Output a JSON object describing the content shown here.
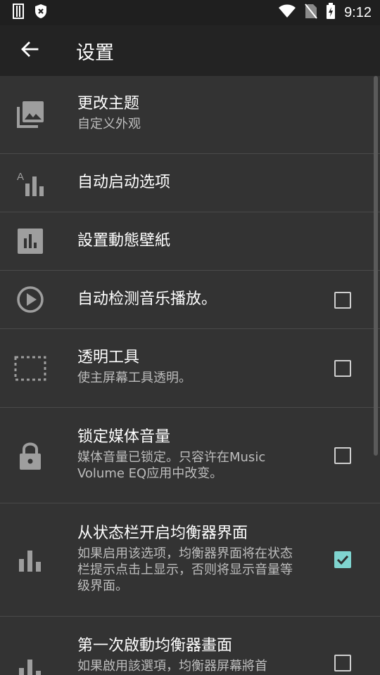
{
  "status_bar": {
    "time": "9:12",
    "icons": [
      "sim-icon",
      "shield-icon",
      "wifi-icon",
      "no-sim-icon",
      "battery-charging-icon"
    ]
  },
  "app_bar": {
    "title": "设置",
    "back_icon": "arrow-back-icon"
  },
  "colors": {
    "background": "#2e2e2e",
    "app_bar": "#232323",
    "accent_checkbox": "#7fd4cf",
    "subtitle_text": "#bdbdbd"
  },
  "settings": [
    {
      "title": "更改主题",
      "subtitle": "自定义外观",
      "icon": "photo-library-icon",
      "checkbox": null
    },
    {
      "title": "自动启动选项",
      "subtitle": "",
      "icon": "auto-equalizer-icon",
      "checkbox": null
    },
    {
      "title": "設置動態壁紙",
      "subtitle": "",
      "icon": "bar-chart-icon",
      "checkbox": null
    },
    {
      "title": "自动检测音乐播放。",
      "subtitle": "",
      "icon": "play-circle-icon",
      "checkbox": false
    },
    {
      "title": "透明工具",
      "subtitle": "使主屏幕工具透明。",
      "icon": "dashed-rectangle-icon",
      "checkbox": false
    },
    {
      "title": "锁定媒体音量",
      "subtitle": "媒体音量已锁定。只容许在Music Volume EQ应用中改变。",
      "icon": "lock-icon",
      "checkbox": false
    },
    {
      "title": "从状态栏开启均衡器界面",
      "subtitle": "如果启用该选项，均衡器界面将在状态栏提示点击上显示，否则将显示音量等级界面。",
      "icon": "equalizer-icon",
      "checkbox": true
    },
    {
      "title": "第一次啟動均衡器畫面",
      "subtitle": "如果啟用該選項，均衡器屏幕將首",
      "icon": "equalizer-icon",
      "checkbox": false
    }
  ]
}
